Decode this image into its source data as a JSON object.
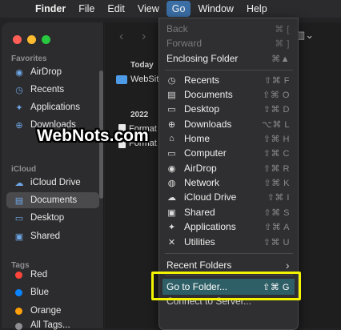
{
  "menubar": {
    "apple": "",
    "items": [
      "Finder",
      "File",
      "Edit",
      "View",
      "Go",
      "Window",
      "Help"
    ]
  },
  "sidebar": {
    "favorites_title": "Favorites",
    "favorites": [
      {
        "label": "AirDrop",
        "icon": "airdrop-icon"
      },
      {
        "label": "Recents",
        "icon": "clock-icon"
      },
      {
        "label": "Applications",
        "icon": "applications-icon"
      },
      {
        "label": "Downloads",
        "icon": "download-icon"
      }
    ],
    "icloud_title": "iCloud",
    "icloud": [
      {
        "label": "iCloud Drive",
        "icon": "cloud-icon"
      },
      {
        "label": "Documents",
        "icon": "document-icon"
      },
      {
        "label": "Desktop",
        "icon": "desktop-icon"
      },
      {
        "label": "Shared",
        "icon": "shared-folder-icon"
      }
    ],
    "tags_title": "Tags",
    "tags": [
      {
        "label": "Red",
        "color": "#ff453a"
      },
      {
        "label": "Blue",
        "color": "#0a84ff"
      },
      {
        "label": "Orange",
        "color": "#ff9f0a"
      },
      {
        "label": "All Tags...",
        "color": "#8e8e93"
      }
    ]
  },
  "content": {
    "group_today": "Today",
    "group_2022": "2022",
    "files": [
      "WebSit",
      "Format",
      "Format"
    ]
  },
  "go_menu": {
    "back": {
      "label": "Back",
      "shortcut": "⌘ ["
    },
    "forward": {
      "label": "Forward",
      "shortcut": "⌘ ]"
    },
    "enclosing": {
      "label": "Enclosing Folder",
      "shortcut": "⌘▲"
    },
    "places": [
      {
        "label": "Recents",
        "shortcut": "⇧⌘ F",
        "icon": "clock-icon"
      },
      {
        "label": "Documents",
        "shortcut": "⇧⌘ O",
        "icon": "document-icon"
      },
      {
        "label": "Desktop",
        "shortcut": "⇧⌘ D",
        "icon": "desktop-icon"
      },
      {
        "label": "Downloads",
        "shortcut": "⌥⌘ L",
        "icon": "download-icon"
      },
      {
        "label": "Home",
        "shortcut": "⇧⌘ H",
        "icon": "home-icon"
      },
      {
        "label": "Computer",
        "shortcut": "⇧⌘ C",
        "icon": "computer-icon"
      },
      {
        "label": "AirDrop",
        "shortcut": "⇧⌘ R",
        "icon": "airdrop-icon"
      },
      {
        "label": "Network",
        "shortcut": "⇧⌘ K",
        "icon": "network-icon"
      },
      {
        "label": "iCloud Drive",
        "shortcut": "⇧⌘ I",
        "icon": "cloud-icon"
      },
      {
        "label": "Shared",
        "shortcut": "⇧⌘ S",
        "icon": "shared-folder-icon"
      },
      {
        "label": "Applications",
        "shortcut": "⇧⌘ A",
        "icon": "applications-icon"
      },
      {
        "label": "Utilities",
        "shortcut": "⇧⌘ U",
        "icon": "utilities-icon"
      }
    ],
    "recent_folders": {
      "label": "Recent Folders",
      "arrow": "›"
    },
    "goto_folder": {
      "label": "Go to Folder...",
      "shortcut": "⇧⌘ G"
    },
    "connect": {
      "label": "Connect to Server..."
    }
  },
  "watermark": "WebNots.com",
  "colors": {
    "highlight_border": "#f4f400",
    "selected_row": "#2f5f66",
    "menu_active": "#3b6ea5"
  }
}
